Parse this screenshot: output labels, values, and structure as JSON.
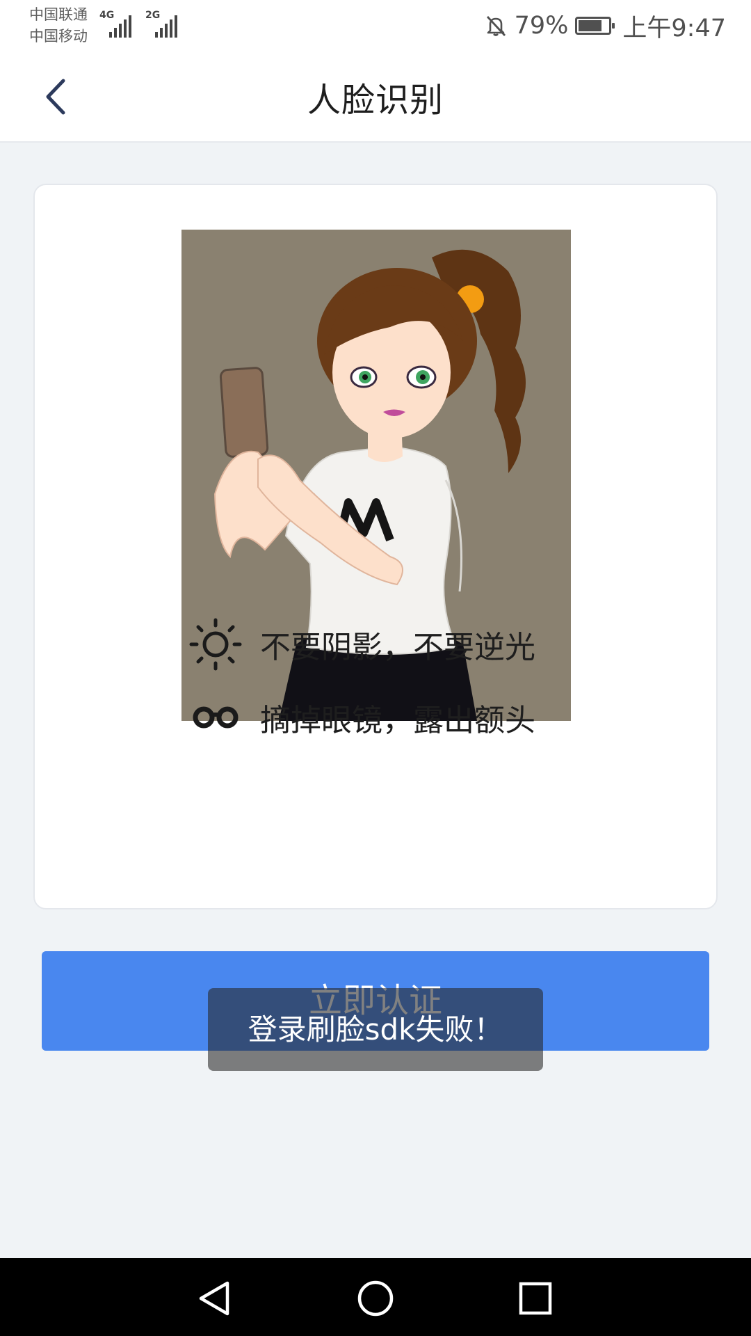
{
  "status_bar": {
    "carrier_1": "中国联通",
    "carrier_2": "中国移动",
    "network_1": "4G",
    "network_2": "2G",
    "battery_percent": "79%",
    "battery_level": 0.79,
    "time": "上午9:47",
    "icons": [
      "signal-icon",
      "bell-off-icon",
      "battery-icon"
    ]
  },
  "header": {
    "title": "人脸识别",
    "back_icon": "chevron-left-icon"
  },
  "card": {
    "illustration": "girl-holding-phone-selfie",
    "tips": [
      {
        "icon": "sun-icon",
        "text": "不要阴影，不要逆光"
      },
      {
        "icon": "glasses-icon",
        "text": "摘掉眼镜，露出额头"
      }
    ]
  },
  "main": {
    "verify_button_label": "立即认证"
  },
  "toast": {
    "message": "登录刷脸sdk失败！"
  },
  "nav_bar": {
    "items": [
      "back-triangle-icon",
      "home-circle-icon",
      "recents-square-icon"
    ]
  },
  "colors": {
    "accent": "#4987ef",
    "background": "#f0f3f6",
    "card": "#ffffff",
    "illustration_bg": "#8a8170"
  }
}
